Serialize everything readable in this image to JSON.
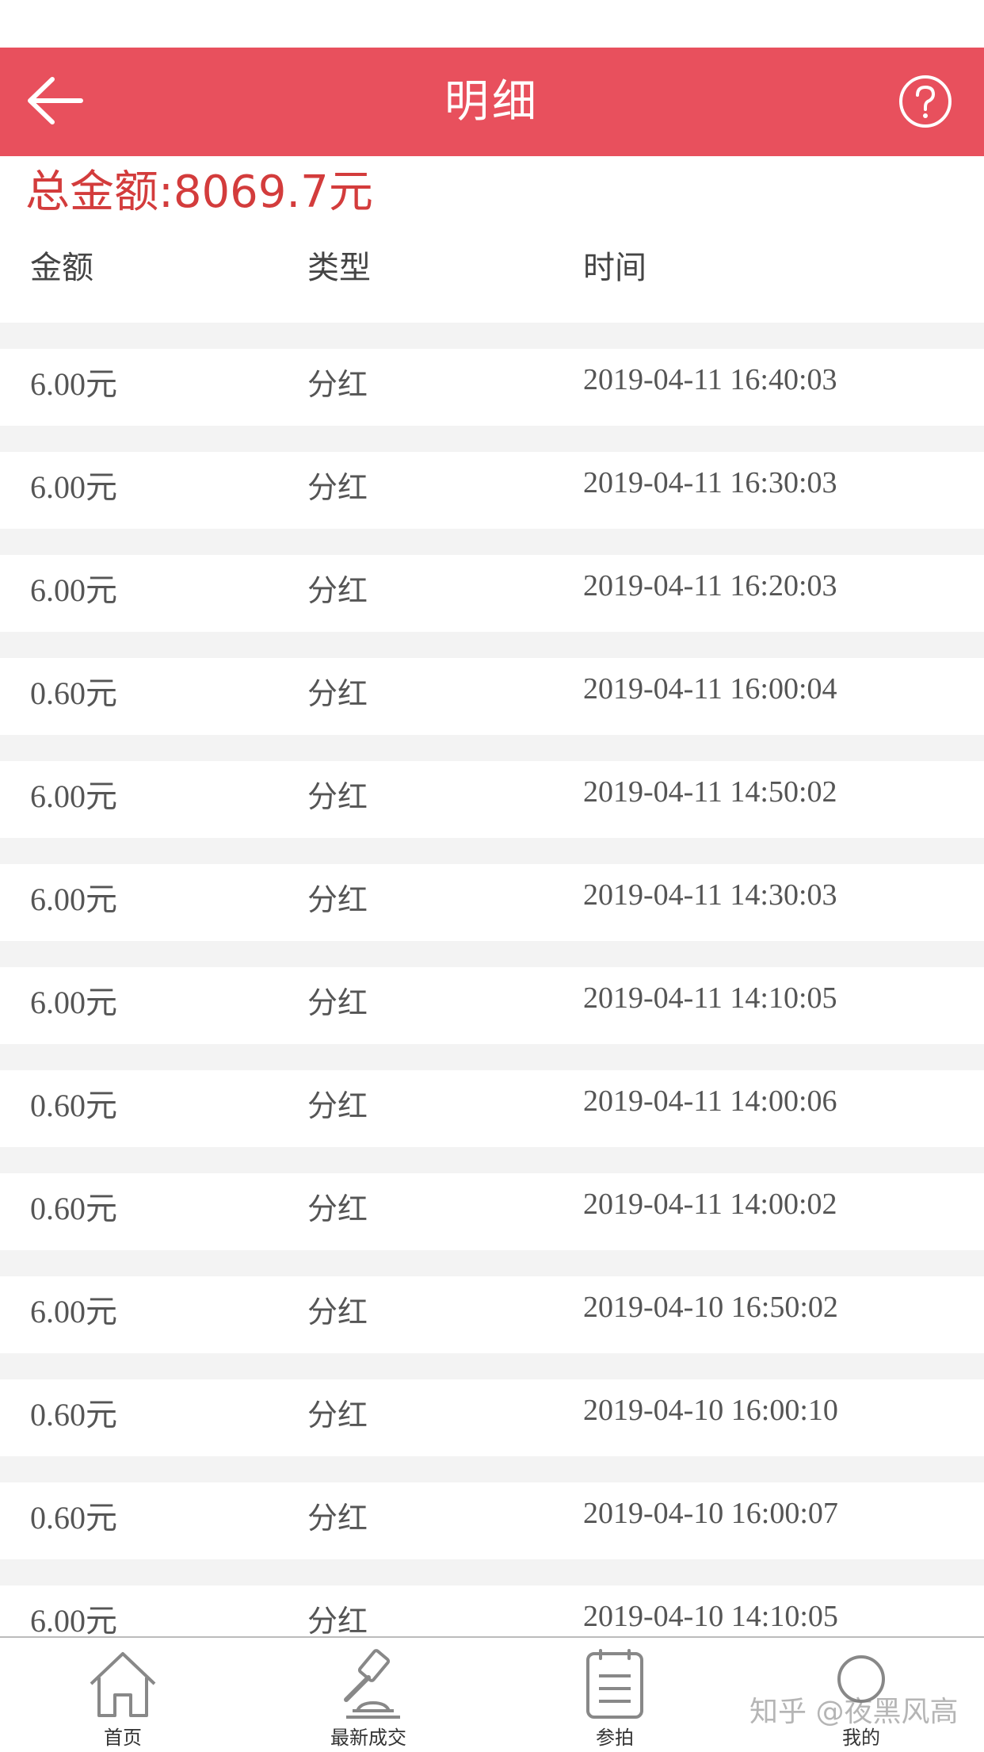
{
  "header": {
    "title": "明细",
    "back_icon": "arrow-left-icon",
    "help_icon": "question-circle-icon",
    "bg_color": "#e8505d"
  },
  "summary": {
    "total": "总金额:8069.7元",
    "color": "#d33c3c"
  },
  "table": {
    "columns": [
      "金额",
      "类型",
      "时间"
    ],
    "rows": [
      {
        "amount": "6.00元",
        "type": "分红",
        "time": "2019-04-11 16:40:03"
      },
      {
        "amount": "6.00元",
        "type": "分红",
        "time": "2019-04-11 16:30:03"
      },
      {
        "amount": "6.00元",
        "type": "分红",
        "time": "2019-04-11 16:20:03"
      },
      {
        "amount": "0.60元",
        "type": "分红",
        "time": "2019-04-11 16:00:04"
      },
      {
        "amount": "6.00元",
        "type": "分红",
        "time": "2019-04-11 14:50:02"
      },
      {
        "amount": "6.00元",
        "type": "分红",
        "time": "2019-04-11 14:30:03"
      },
      {
        "amount": "6.00元",
        "type": "分红",
        "time": "2019-04-11 14:10:05"
      },
      {
        "amount": "0.60元",
        "type": "分红",
        "time": "2019-04-11 14:00:06"
      },
      {
        "amount": "0.60元",
        "type": "分红",
        "time": "2019-04-11 14:00:02"
      },
      {
        "amount": "6.00元",
        "type": "分红",
        "time": "2019-04-10 16:50:02"
      },
      {
        "amount": "0.60元",
        "type": "分红",
        "time": "2019-04-10 16:00:10"
      },
      {
        "amount": "0.60元",
        "type": "分红",
        "time": "2019-04-10 16:00:07"
      },
      {
        "amount": "6.00元",
        "type": "分红",
        "time": "2019-04-10 14:10:05"
      }
    ]
  },
  "tabbar": {
    "items": [
      {
        "label": "首页",
        "icon": "home-icon"
      },
      {
        "label": "最新成交",
        "icon": "gavel-icon"
      },
      {
        "label": "参拍",
        "icon": "clipboard-icon"
      },
      {
        "label": "我的",
        "icon": "user-icon"
      }
    ]
  },
  "watermark": "知乎 @夜黑风高"
}
